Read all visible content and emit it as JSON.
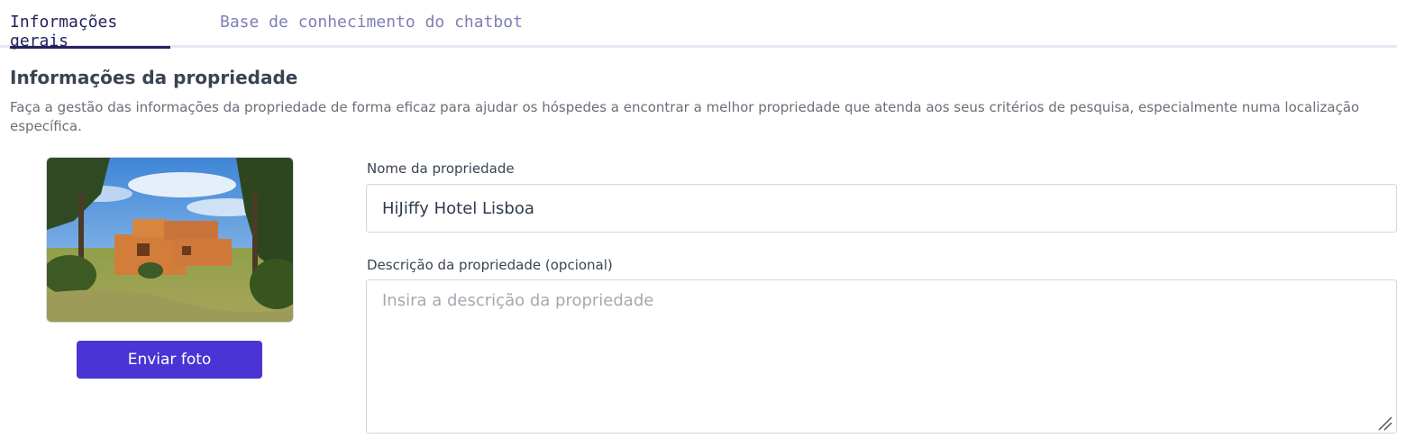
{
  "tabs": [
    {
      "label": "Informações gerais",
      "active": true
    },
    {
      "label": "Base de conhecimento do chatbot",
      "active": false
    }
  ],
  "section": {
    "title": "Informações da propriedade",
    "description": "Faça a gestão das informações da propriedade de forma eficaz para ajudar os hóspedes a encontrar a melhor propriedade que atenda aos seus critérios de pesquisa, especialmente numa localização específica."
  },
  "photo": {
    "upload_label": "Enviar foto"
  },
  "form": {
    "name_label": "Nome da propriedade",
    "name_value": "HiJiffy Hotel Lisboa",
    "description_label": "Descrição da propriedade (opcional)",
    "description_placeholder": "Insira a descrição da propriedade",
    "description_value": ""
  },
  "colors": {
    "accent": "#4a35d4",
    "tab_active": "#23225c",
    "tab_inactive": "#7f7eb6"
  }
}
